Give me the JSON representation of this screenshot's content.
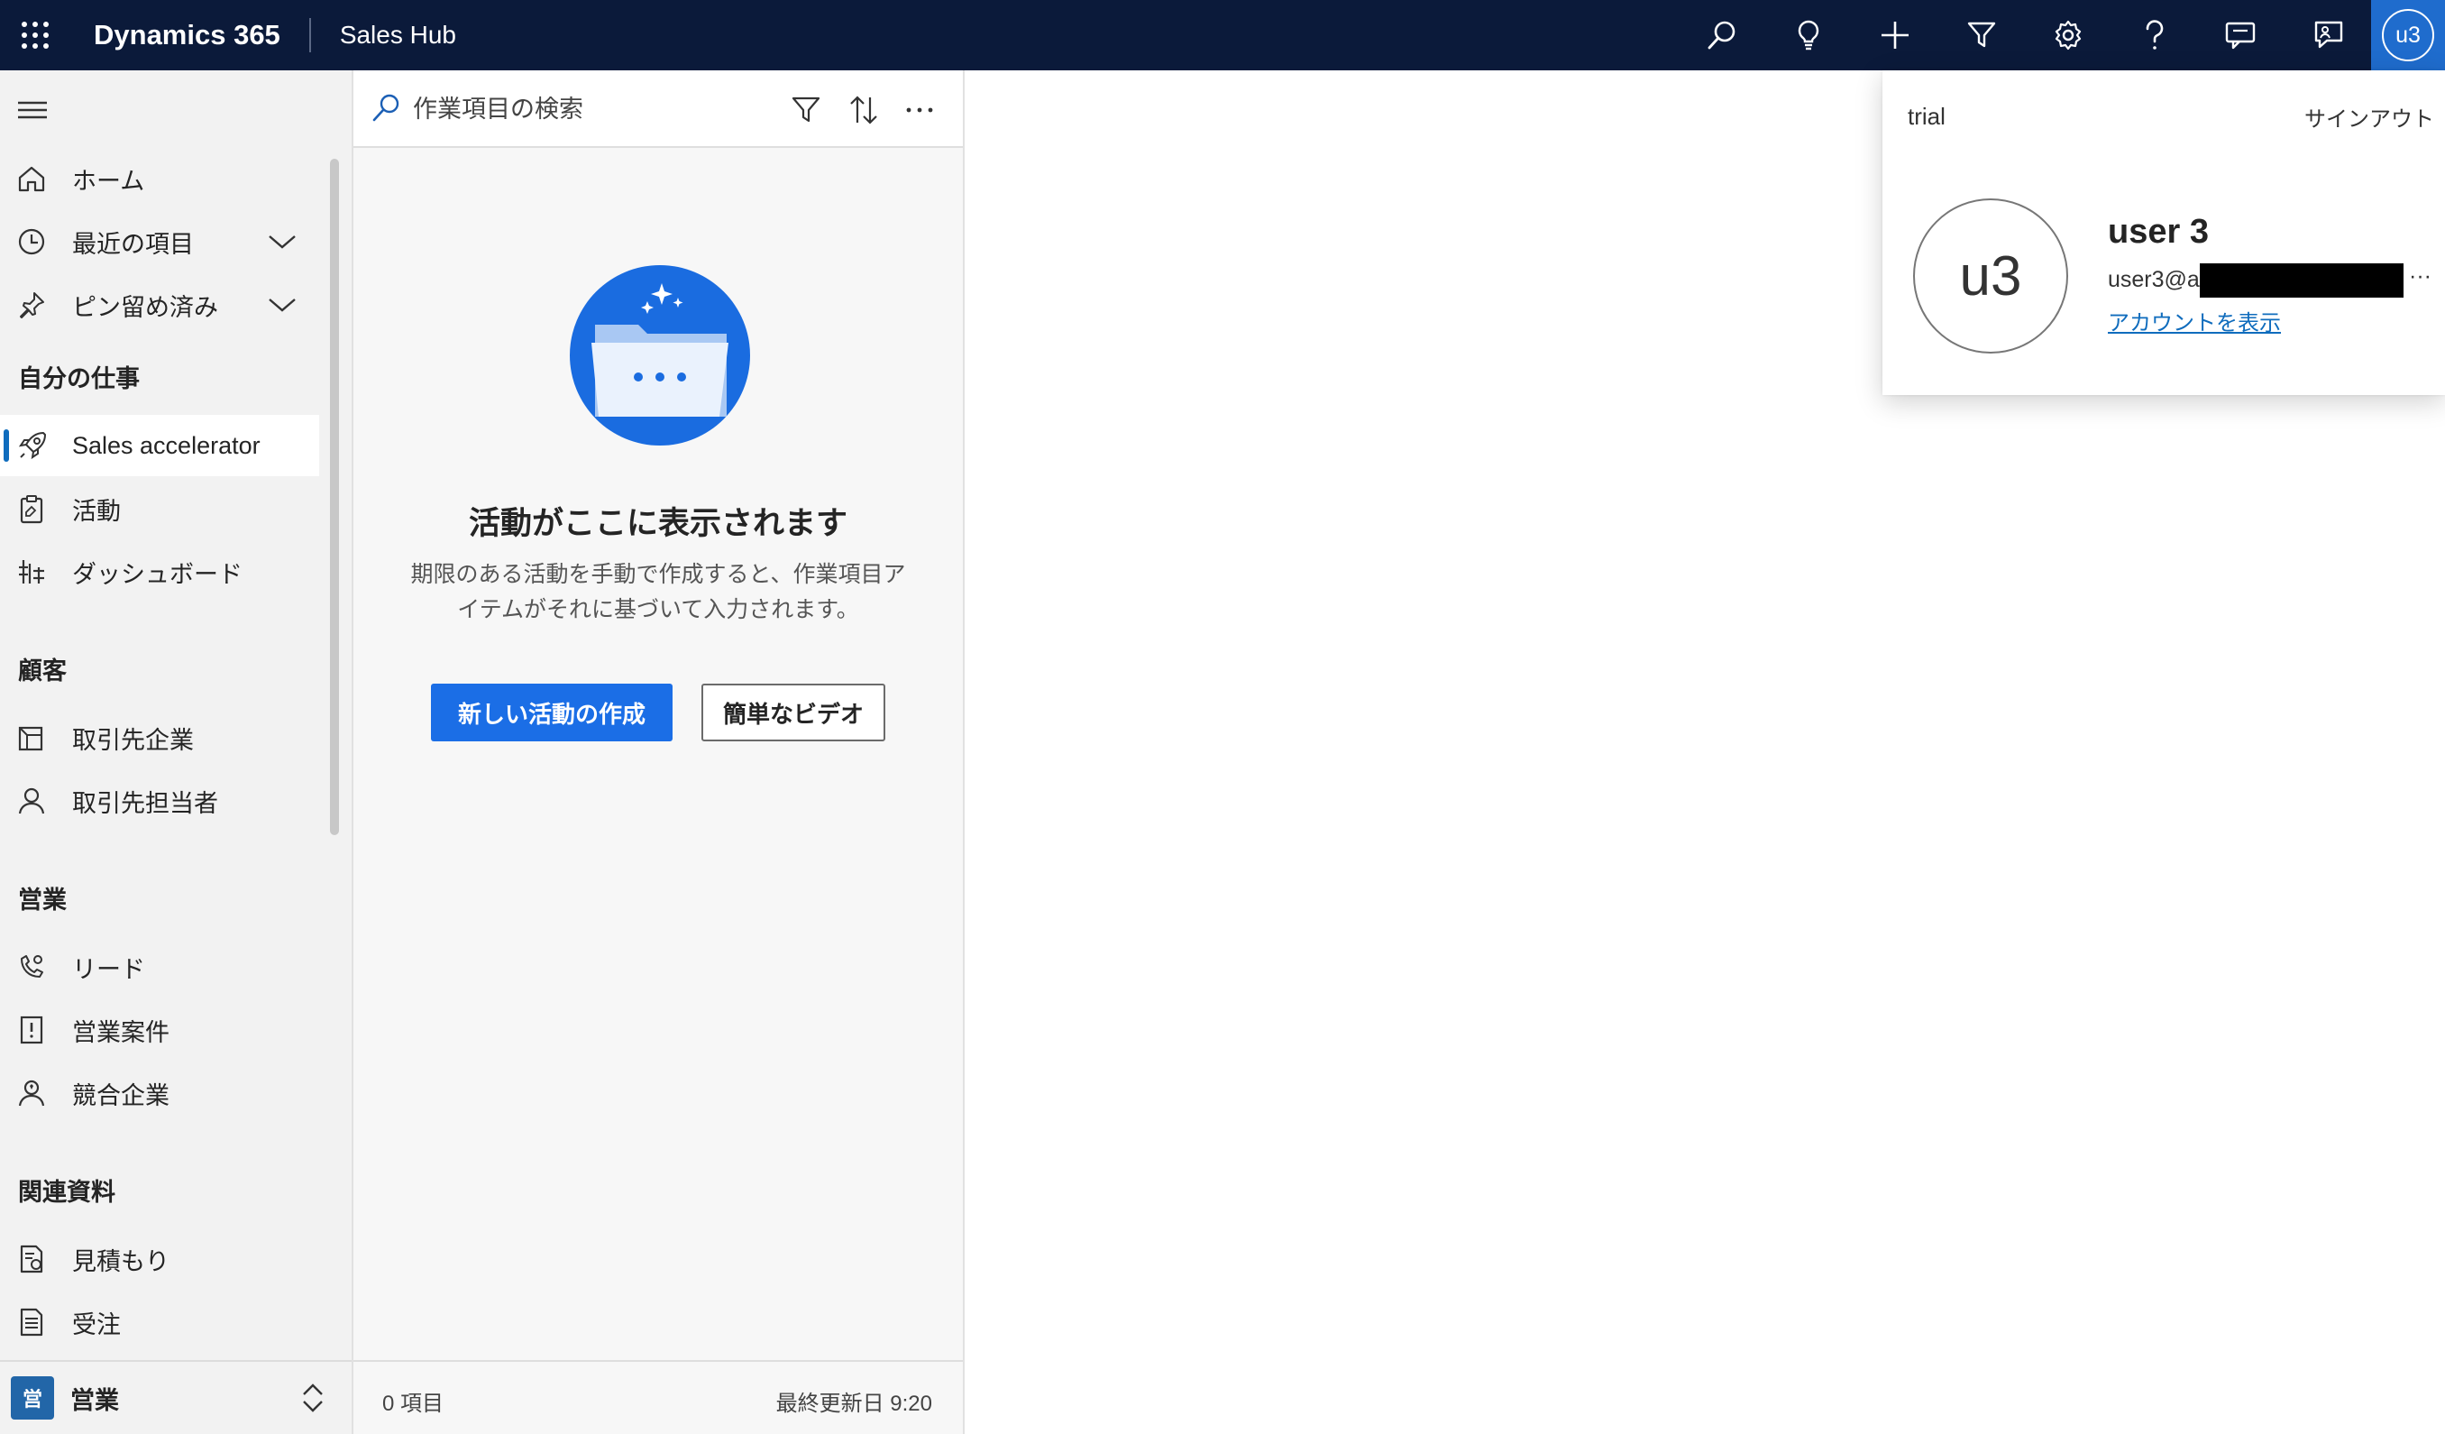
{
  "topbar": {
    "app_title": "Dynamics 365",
    "hub_title": "Sales Hub",
    "icons": [
      "search-icon",
      "lightbulb-icon",
      "plus-icon",
      "filter-icon",
      "settings-icon",
      "help-icon",
      "chat-icon",
      "feedback-icon"
    ],
    "avatar_initials": "u3",
    "bg_color": "#0b1a3a",
    "avatar_color": "#1f6ccd"
  },
  "sidebar": {
    "top_items": [
      {
        "label": "ホーム",
        "icon": "home-icon"
      },
      {
        "label": "最近の項目",
        "icon": "clock-icon",
        "expandable": true
      },
      {
        "label": "ピン留め済み",
        "icon": "pin-icon",
        "expandable": true
      }
    ],
    "groups": [
      {
        "title": "自分の仕事",
        "items": [
          {
            "label": "Sales accelerator",
            "icon": "rocket-icon",
            "selected": true
          },
          {
            "label": "活動",
            "icon": "clipboard-icon"
          },
          {
            "label": "ダッシュボード",
            "icon": "dashboard-icon"
          }
        ]
      },
      {
        "title": "顧客",
        "items": [
          {
            "label": "取引先企業",
            "icon": "building-icon"
          },
          {
            "label": "取引先担当者",
            "icon": "person-icon"
          }
        ]
      },
      {
        "title": "営業",
        "items": [
          {
            "label": "リード",
            "icon": "phone-person-icon"
          },
          {
            "label": "営業案件",
            "icon": "opportunity-icon"
          },
          {
            "label": "競合企業",
            "icon": "competitor-icon"
          }
        ]
      },
      {
        "title": "関連資料",
        "items": [
          {
            "label": "見積もり",
            "icon": "quote-icon"
          },
          {
            "label": "受注",
            "icon": "order-icon"
          }
        ]
      }
    ],
    "area": {
      "badge": "営",
      "label": "営業"
    }
  },
  "worklist": {
    "search_placeholder": "作業項目の検索",
    "empty_title": "活動がここに表示されます",
    "empty_desc_line1": "期限のある活動を手動で作成すると、作業項目ア",
    "empty_desc_line2": "イテムがそれに基づいて入力されます。",
    "primary_button": "新しい活動の作成",
    "secondary_button": "簡単なビデオ",
    "footer_count": "0 項目",
    "footer_updated": "最終更新日 9:20",
    "accent_color": "#1b6ee6"
  },
  "account": {
    "org_name": "trial",
    "sign_out": "サインアウト",
    "initials": "u3",
    "user_name": "user 3",
    "email_visible": "user3@a",
    "email_more": "···",
    "view_account": "アカウントを表示"
  }
}
